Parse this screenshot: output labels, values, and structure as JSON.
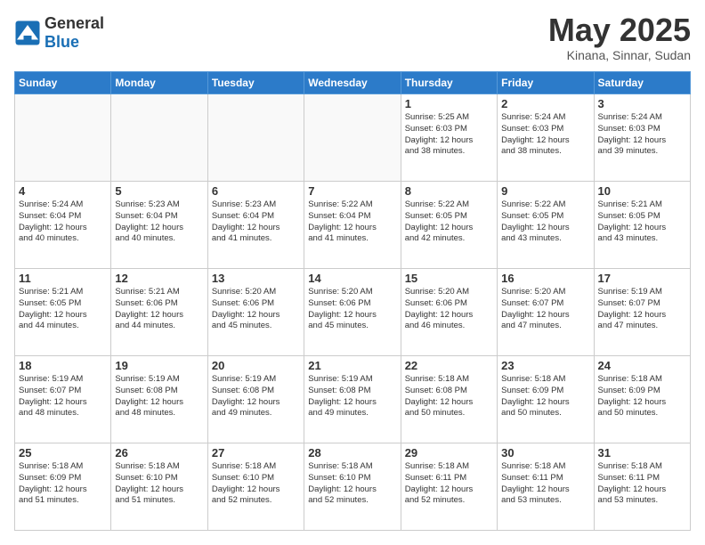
{
  "logo": {
    "general": "General",
    "blue": "Blue"
  },
  "title": "May 2025",
  "location": "Kinana, Sinnar, Sudan",
  "days": [
    "Sunday",
    "Monday",
    "Tuesday",
    "Wednesday",
    "Thursday",
    "Friday",
    "Saturday"
  ],
  "weeks": [
    [
      {
        "day": "",
        "info": ""
      },
      {
        "day": "",
        "info": ""
      },
      {
        "day": "",
        "info": ""
      },
      {
        "day": "",
        "info": ""
      },
      {
        "day": "1",
        "info": "Sunrise: 5:25 AM\nSunset: 6:03 PM\nDaylight: 12 hours\nand 38 minutes."
      },
      {
        "day": "2",
        "info": "Sunrise: 5:24 AM\nSunset: 6:03 PM\nDaylight: 12 hours\nand 38 minutes."
      },
      {
        "day": "3",
        "info": "Sunrise: 5:24 AM\nSunset: 6:03 PM\nDaylight: 12 hours\nand 39 minutes."
      }
    ],
    [
      {
        "day": "4",
        "info": "Sunrise: 5:24 AM\nSunset: 6:04 PM\nDaylight: 12 hours\nand 40 minutes."
      },
      {
        "day": "5",
        "info": "Sunrise: 5:23 AM\nSunset: 6:04 PM\nDaylight: 12 hours\nand 40 minutes."
      },
      {
        "day": "6",
        "info": "Sunrise: 5:23 AM\nSunset: 6:04 PM\nDaylight: 12 hours\nand 41 minutes."
      },
      {
        "day": "7",
        "info": "Sunrise: 5:22 AM\nSunset: 6:04 PM\nDaylight: 12 hours\nand 41 minutes."
      },
      {
        "day": "8",
        "info": "Sunrise: 5:22 AM\nSunset: 6:05 PM\nDaylight: 12 hours\nand 42 minutes."
      },
      {
        "day": "9",
        "info": "Sunrise: 5:22 AM\nSunset: 6:05 PM\nDaylight: 12 hours\nand 43 minutes."
      },
      {
        "day": "10",
        "info": "Sunrise: 5:21 AM\nSunset: 6:05 PM\nDaylight: 12 hours\nand 43 minutes."
      }
    ],
    [
      {
        "day": "11",
        "info": "Sunrise: 5:21 AM\nSunset: 6:05 PM\nDaylight: 12 hours\nand 44 minutes."
      },
      {
        "day": "12",
        "info": "Sunrise: 5:21 AM\nSunset: 6:06 PM\nDaylight: 12 hours\nand 44 minutes."
      },
      {
        "day": "13",
        "info": "Sunrise: 5:20 AM\nSunset: 6:06 PM\nDaylight: 12 hours\nand 45 minutes."
      },
      {
        "day": "14",
        "info": "Sunrise: 5:20 AM\nSunset: 6:06 PM\nDaylight: 12 hours\nand 45 minutes."
      },
      {
        "day": "15",
        "info": "Sunrise: 5:20 AM\nSunset: 6:06 PM\nDaylight: 12 hours\nand 46 minutes."
      },
      {
        "day": "16",
        "info": "Sunrise: 5:20 AM\nSunset: 6:07 PM\nDaylight: 12 hours\nand 47 minutes."
      },
      {
        "day": "17",
        "info": "Sunrise: 5:19 AM\nSunset: 6:07 PM\nDaylight: 12 hours\nand 47 minutes."
      }
    ],
    [
      {
        "day": "18",
        "info": "Sunrise: 5:19 AM\nSunset: 6:07 PM\nDaylight: 12 hours\nand 48 minutes."
      },
      {
        "day": "19",
        "info": "Sunrise: 5:19 AM\nSunset: 6:08 PM\nDaylight: 12 hours\nand 48 minutes."
      },
      {
        "day": "20",
        "info": "Sunrise: 5:19 AM\nSunset: 6:08 PM\nDaylight: 12 hours\nand 49 minutes."
      },
      {
        "day": "21",
        "info": "Sunrise: 5:19 AM\nSunset: 6:08 PM\nDaylight: 12 hours\nand 49 minutes."
      },
      {
        "day": "22",
        "info": "Sunrise: 5:18 AM\nSunset: 6:08 PM\nDaylight: 12 hours\nand 50 minutes."
      },
      {
        "day": "23",
        "info": "Sunrise: 5:18 AM\nSunset: 6:09 PM\nDaylight: 12 hours\nand 50 minutes."
      },
      {
        "day": "24",
        "info": "Sunrise: 5:18 AM\nSunset: 6:09 PM\nDaylight: 12 hours\nand 50 minutes."
      }
    ],
    [
      {
        "day": "25",
        "info": "Sunrise: 5:18 AM\nSunset: 6:09 PM\nDaylight: 12 hours\nand 51 minutes."
      },
      {
        "day": "26",
        "info": "Sunrise: 5:18 AM\nSunset: 6:10 PM\nDaylight: 12 hours\nand 51 minutes."
      },
      {
        "day": "27",
        "info": "Sunrise: 5:18 AM\nSunset: 6:10 PM\nDaylight: 12 hours\nand 52 minutes."
      },
      {
        "day": "28",
        "info": "Sunrise: 5:18 AM\nSunset: 6:10 PM\nDaylight: 12 hours\nand 52 minutes."
      },
      {
        "day": "29",
        "info": "Sunrise: 5:18 AM\nSunset: 6:11 PM\nDaylight: 12 hours\nand 52 minutes."
      },
      {
        "day": "30",
        "info": "Sunrise: 5:18 AM\nSunset: 6:11 PM\nDaylight: 12 hours\nand 53 minutes."
      },
      {
        "day": "31",
        "info": "Sunrise: 5:18 AM\nSunset: 6:11 PM\nDaylight: 12 hours\nand 53 minutes."
      }
    ]
  ]
}
